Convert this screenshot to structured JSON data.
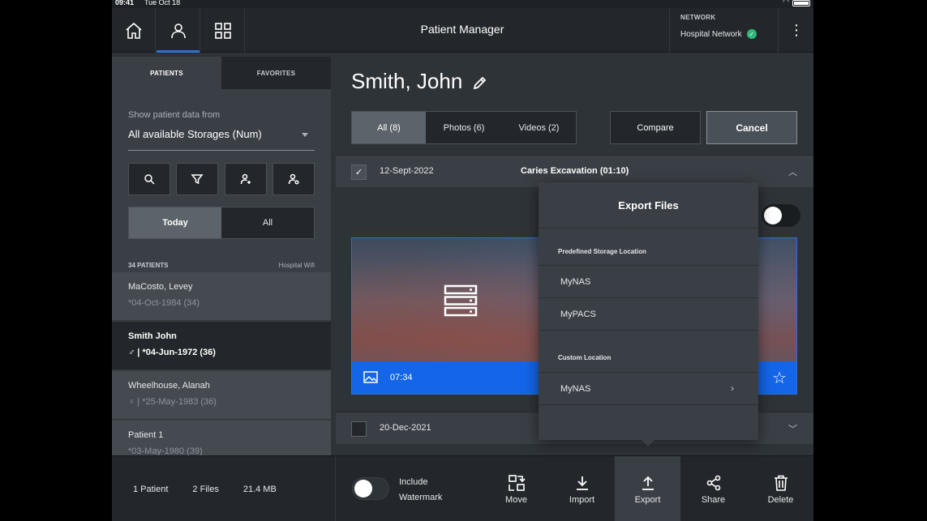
{
  "status_bar": {
    "time": "09:41",
    "date": "Tue Oct 18"
  },
  "app": {
    "title": "Patient Manager"
  },
  "nav": [
    {
      "name": "home",
      "icon": "home-icon"
    },
    {
      "name": "patients",
      "icon": "person-icon",
      "active": true
    },
    {
      "name": "apps",
      "icon": "grid-icon"
    }
  ],
  "network": {
    "label": "NETWORK",
    "name": "Hospital Network",
    "status": "connected"
  },
  "left": {
    "tabs": [
      "PATIENTS",
      "FAVORITES"
    ],
    "active_tab": "PATIENTS",
    "storage_label": "Show patient data from",
    "storage_value": "All available Storages (Num)",
    "tools": [
      "search-icon",
      "filter-icon",
      "add-person-icon",
      "person-settings-icon"
    ],
    "day_options": [
      "Today",
      "All"
    ],
    "list_count": "34 PATIENTS",
    "list_source": "Hospital Wifi",
    "patients": [
      {
        "name": "MaCosto, Levey",
        "info": "*04-Oct-1984 (34)"
      },
      {
        "name": "Smith John",
        "info": "♂ | *04-Jun-1972 (36)",
        "selected": true
      },
      {
        "name": "Wheelhouse, Alanah",
        "info": "♀ | *25-May-1983 (36)"
      },
      {
        "name": "Patient 1",
        "info": "*03-May-1980 (39)"
      }
    ]
  },
  "main": {
    "patient_name": "Smith, John",
    "filters": [
      "All (8)",
      "Photos (6)",
      "Videos (2)"
    ],
    "compare_label": "Compare",
    "cancel_label": "Cancel",
    "sessions": [
      {
        "date": "12-Sept-2022",
        "title": "Caries Excavation (01:10)",
        "checked": true,
        "expanded": true
      },
      {
        "date": "20-Dec-2021",
        "title": "",
        "checked": false,
        "expanded": false
      }
    ],
    "media": {
      "duration": "07:34"
    }
  },
  "export_popover": {
    "title": "Export Files",
    "predefined_label": "Predefined Storage Location",
    "predefined_items": [
      "MyNAS",
      "MyPACS"
    ],
    "custom_label": "Custom Location",
    "custom_items": [
      "MyNAS"
    ]
  },
  "bottom": {
    "patients": "1 Patient",
    "files": "2 Files",
    "size": "21.4 MB",
    "watermark_label": "Include Watermark",
    "actions": [
      "Move",
      "Import",
      "Export",
      "Share",
      "Delete"
    ],
    "active_action": "Export"
  },
  "colors": {
    "accent": "#2f6fd6",
    "media_bar": "#1465e8",
    "ok": "#2fb87a"
  }
}
